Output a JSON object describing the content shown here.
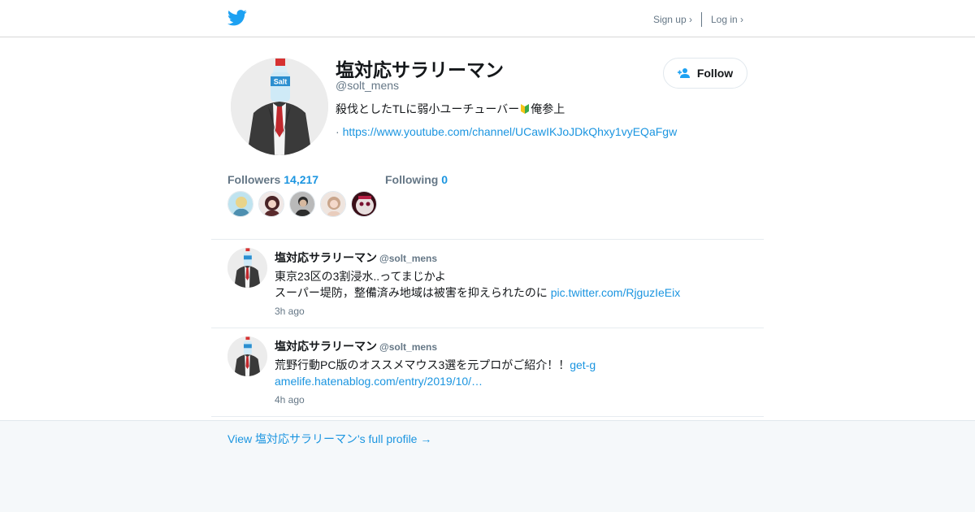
{
  "header": {
    "signup_label": "Sign up ›",
    "login_label": "Log in ›"
  },
  "profile": {
    "name": "塩対応サラリーマン",
    "handle": "@solt_mens",
    "bio_before": "殺伐としたTLに弱小ユーチューバー",
    "bio_after": "俺参上",
    "url_prefix": "·",
    "url": "https://www.youtube.com/channel/UCawIKJoJDkQhxy1vyEQaFgw",
    "follow_label": "Follow",
    "avatar_text": "Salt"
  },
  "stats": {
    "followers_label": "Followers",
    "followers_count": "14,217",
    "following_label": "Following",
    "following_count": "0"
  },
  "tweets": [
    {
      "name": "塩対応サラリーマン",
      "handle": "@solt_mens",
      "line1": "東京23区の3割浸水..ってまじかよ",
      "line2": "スーパー堤防，整備済み地域は被害を抑えられたのに ",
      "link": "pic.twitter.com/RjguzIeEix",
      "time": "3h ago"
    },
    {
      "name": "塩対応サラリーマン",
      "handle": "@solt_mens",
      "line1": "荒野行動PC版のオススメマウス3選を元プロがご紹介！！",
      "link": "get-gamelife.hatenablog.com/entry/2019/10/…",
      "time": "4h ago"
    }
  ],
  "footer": {
    "full_profile_label": "View 塩対応サラリーマン's full profile →"
  },
  "colors": {
    "accent": "#1b95e0",
    "twitter_blue": "#1da1f2",
    "muted": "#657786"
  }
}
